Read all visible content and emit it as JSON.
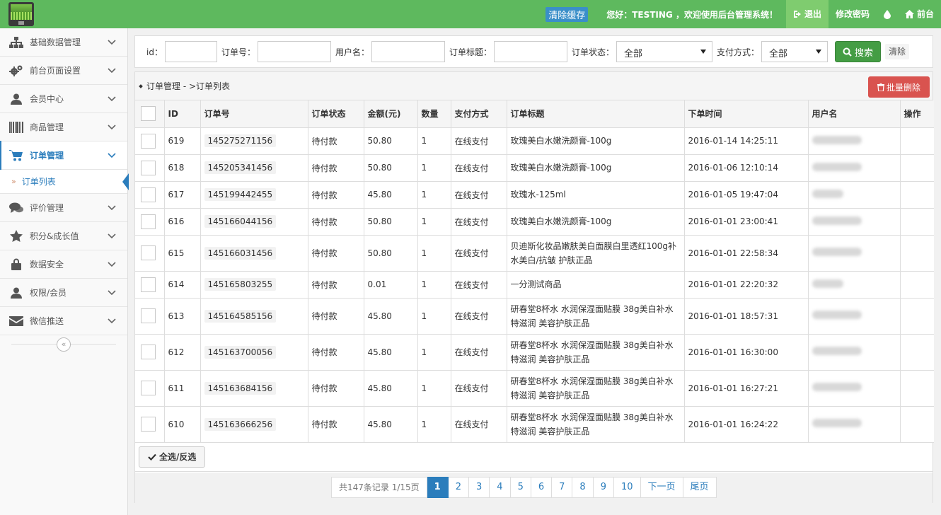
{
  "header": {
    "clear_cache": "清除缓存",
    "welcome": "您好：TESTING ，欢迎使用后台管理系统！",
    "logout": "退出",
    "change_password": "修改密码",
    "frontend": "前台"
  },
  "sidebar": {
    "items": [
      {
        "label": "基础数据管理",
        "icon": "sitemap-icon"
      },
      {
        "label": "前台页面设置",
        "icon": "gears-icon"
      },
      {
        "label": "会员中心",
        "icon": "user-icon"
      },
      {
        "label": "商品管理",
        "icon": "barcode-icon"
      },
      {
        "label": "订单管理",
        "icon": "cart-icon"
      },
      {
        "label": "评价管理",
        "icon": "comments-icon"
      },
      {
        "label": "积分&成长值",
        "icon": "star-icon"
      },
      {
        "label": "数据安全",
        "icon": "lock-icon"
      },
      {
        "label": "权限/会员",
        "icon": "user-icon"
      },
      {
        "label": "微信推送",
        "icon": "envelope-icon"
      }
    ],
    "sub_item": "订单列表"
  },
  "filter": {
    "id_label": "id：",
    "order_no_label": "订单号：",
    "username_label": "用户名：",
    "title_label": "订单标题：",
    "status_label": "订单状态：",
    "status_value": "全部",
    "payment_label": "支付方式：",
    "payment_value": "全部",
    "search_label": "搜索",
    "clear_label": "清除"
  },
  "panel": {
    "breadcrumb": "订单管理 - >订单列表",
    "batch_delete": "批量删除",
    "select_all": "全选/反选"
  },
  "table": {
    "headers": [
      "ID",
      "订单号",
      "订单状态",
      "金额(元)",
      "数量",
      "支付方式",
      "订单标题",
      "下单时间",
      "用户名",
      "操作"
    ],
    "rows": [
      {
        "id": "619",
        "order_no": "145275271156",
        "status": "待付款",
        "amount": "50.80",
        "qty": "1",
        "payment": "在线支付",
        "title": "玫瑰美白水嫩洗颜膏-100g",
        "time": "2016-01-14 14:25:11"
      },
      {
        "id": "618",
        "order_no": "145205341456",
        "status": "待付款",
        "amount": "50.80",
        "qty": "1",
        "payment": "在线支付",
        "title": "玫瑰美白水嫩洗颜膏-100g",
        "time": "2016-01-06 12:10:14"
      },
      {
        "id": "617",
        "order_no": "145199442455",
        "status": "待付款",
        "amount": "45.80",
        "qty": "1",
        "payment": "在线支付",
        "title": "玫瑰水-125ml",
        "time": "2016-01-05 19:47:04"
      },
      {
        "id": "616",
        "order_no": "145166044156",
        "status": "待付款",
        "amount": "50.80",
        "qty": "1",
        "payment": "在线支付",
        "title": "玫瑰美白水嫩洗颜膏-100g",
        "time": "2016-01-01 23:00:41"
      },
      {
        "id": "615",
        "order_no": "145166031456",
        "status": "待付款",
        "amount": "50.80",
        "qty": "1",
        "payment": "在线支付",
        "title": "贝迪斯化妆品嫩肤美白面膜白里透红100g补水美白/抗皱 护肤正品",
        "time": "2016-01-01 22:58:34"
      },
      {
        "id": "614",
        "order_no": "145165803255",
        "status": "待付款",
        "amount": "0.01",
        "qty": "1",
        "payment": "在线支付",
        "title": "一分测试商品",
        "time": "2016-01-01 22:20:32"
      },
      {
        "id": "613",
        "order_no": "145164585156",
        "status": "待付款",
        "amount": "45.80",
        "qty": "1",
        "payment": "在线支付",
        "title": "研春堂8杯水 水润保湿面贴膜 38g美白补水特滋润 美容护肤正品",
        "time": "2016-01-01 18:57:31"
      },
      {
        "id": "612",
        "order_no": "145163700056",
        "status": "待付款",
        "amount": "45.80",
        "qty": "1",
        "payment": "在线支付",
        "title": "研春堂8杯水 水润保湿面贴膜 38g美白补水特滋润 美容护肤正品",
        "time": "2016-01-01 16:30:00"
      },
      {
        "id": "611",
        "order_no": "145163684156",
        "status": "待付款",
        "amount": "45.80",
        "qty": "1",
        "payment": "在线支付",
        "title": "研春堂8杯水 水润保湿面贴膜 38g美白补水特滋润 美容护肤正品",
        "time": "2016-01-01 16:27:21"
      },
      {
        "id": "610",
        "order_no": "145163666256",
        "status": "待付款",
        "amount": "45.80",
        "qty": "1",
        "payment": "在线支付",
        "title": "研春堂8杯水 水润保湿面贴膜 38g美白补水特滋润 美容护肤正品",
        "time": "2016-01-01 16:24:22"
      }
    ]
  },
  "pagination": {
    "info": "共147条记录 1/15页",
    "pages": [
      "1",
      "2",
      "3",
      "4",
      "5",
      "6",
      "7",
      "8",
      "9",
      "10"
    ],
    "current": "1",
    "next": "下一页",
    "last": "尾页"
  },
  "colors": {
    "topbar": "#5eb95e",
    "primary": "#2b7dbc",
    "search_button": "#449d44",
    "danger": "#d9534f"
  }
}
